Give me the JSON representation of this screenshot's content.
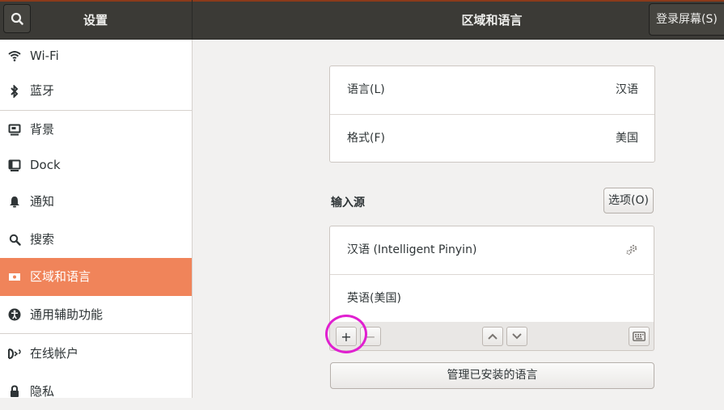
{
  "header": {
    "left_title": "设置",
    "main_title": "区域和语言",
    "login_screen_label": "登录屏幕(S)"
  },
  "sidebar": {
    "items": [
      {
        "label": "Wi-Fi",
        "icon": "wifi-icon"
      },
      {
        "label": "蓝牙",
        "icon": "bluetooth-icon"
      },
      {
        "label": "背景",
        "icon": "background-icon"
      },
      {
        "label": "Dock",
        "icon": "dock-icon"
      },
      {
        "label": "通知",
        "icon": "bell-icon"
      },
      {
        "label": "搜索",
        "icon": "search-icon"
      },
      {
        "label": "区域和语言",
        "icon": "region-flag-icon",
        "active": true
      },
      {
        "label": "通用辅助功能",
        "icon": "accessibility-icon"
      },
      {
        "label": "在线帐户",
        "icon": "online-accounts-icon"
      },
      {
        "label": "隐私",
        "icon": "privacy-icon"
      }
    ]
  },
  "language_panel": {
    "rows": [
      {
        "label": "语言(L)",
        "value": "汉语"
      },
      {
        "label": "格式(F)",
        "value": "美国"
      }
    ]
  },
  "input_sources": {
    "title": "输入源",
    "options_button": "选项(O)",
    "items": [
      {
        "label": "汉语 (Intelligent Pinyin)",
        "has_settings": true
      },
      {
        "label": "英语(美国)",
        "has_settings": false
      }
    ],
    "toolbar": {
      "add": "+",
      "remove": "−"
    }
  },
  "manage_button": "管理已安装的语言",
  "colors": {
    "active_item": "#f0845a",
    "header_bg": "#3b3a36",
    "highlight_circle": "#e020d0"
  }
}
